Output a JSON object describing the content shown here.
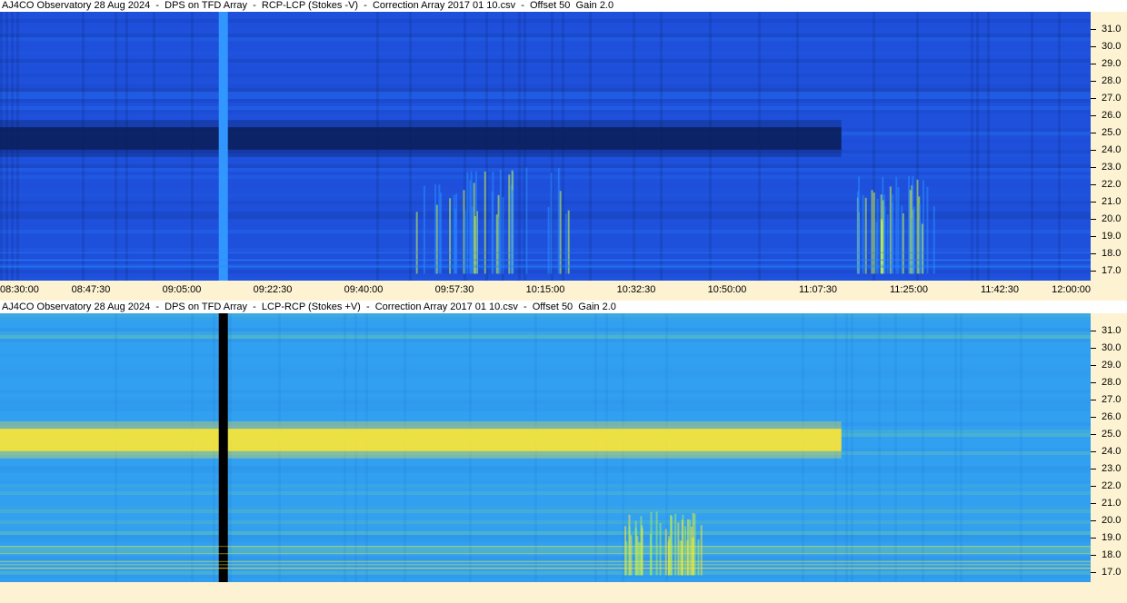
{
  "chart_data": [
    {
      "type": "heatmap",
      "title": "AJ4CO Observatory 28 Aug 2024  -  DPS on TFD Array  -  RCP-LCP (Stokes -V)  -  Correction Array 2017 01 10.csv  -  Offset 50  Gain 2.0",
      "x_ticks": [
        "08:30:00",
        "08:47:30",
        "09:05:00",
        "09:22:30",
        "09:40:00",
        "09:57:30",
        "10:15:00",
        "10:32:30",
        "10:50:00",
        "11:07:30",
        "11:25:00",
        "11:42:30",
        "12:00:00"
      ],
      "y_ticks": [
        "17.0",
        "18.0",
        "19.0",
        "20.0",
        "21.0",
        "22.0",
        "23.0",
        "24.0",
        "25.0",
        "26.0",
        "27.0",
        "28.0",
        "29.0",
        "30.0",
        "31.0"
      ],
      "ylim": [
        16.4,
        32.0
      ],
      "colors": {
        "low": "#0a1e5a",
        "mid": "#1e50dc",
        "high": "#2a8cff",
        "bright": "#d2ff3c"
      },
      "features": [
        {
          "kind": "dark_band",
          "freq": [
            24.0,
            25.3
          ],
          "time": [
            "08:30:00",
            "11:12:00"
          ]
        },
        {
          "kind": "vertical_line",
          "time": "09:13:00",
          "color": "#3296ff"
        },
        {
          "kind": "burst_cluster",
          "time": [
            "09:50:00",
            "10:20:00"
          ],
          "freq": [
            16.8,
            23.0
          ]
        },
        {
          "kind": "burst_cluster",
          "time": [
            "11:15:00",
            "11:30:00"
          ],
          "freq": [
            16.8,
            22.5
          ]
        }
      ]
    },
    {
      "type": "heatmap",
      "title": "AJ4CO Observatory 28 Aug 2024  -  DPS on TFD Array  -  LCP-RCP (Stokes +V)  -  Correction Array 2017 01 10.csv  -  Offset 50  Gain 2.0",
      "x_ticks": [],
      "y_ticks": [
        "17.0",
        "18.0",
        "19.0",
        "20.0",
        "21.0",
        "22.0",
        "23.0",
        "24.0",
        "25.0",
        "26.0",
        "27.0",
        "28.0",
        "29.0",
        "30.0",
        "31.0"
      ],
      "ylim": [
        16.4,
        32.0
      ],
      "colors": {
        "low": "#1e78dc",
        "mid": "#32a0f0",
        "high": "#a0f064",
        "bright": "#ffe632"
      },
      "features": [
        {
          "kind": "bright_band",
          "freq": [
            24.0,
            25.3
          ],
          "time": [
            "08:30:00",
            "11:12:00"
          ]
        },
        {
          "kind": "vertical_line",
          "time": "09:13:00",
          "color": "#000000"
        },
        {
          "kind": "burst_cluster",
          "time": [
            "10:30:00",
            "10:45:00"
          ],
          "freq": [
            16.8,
            20.5
          ]
        }
      ]
    }
  ]
}
